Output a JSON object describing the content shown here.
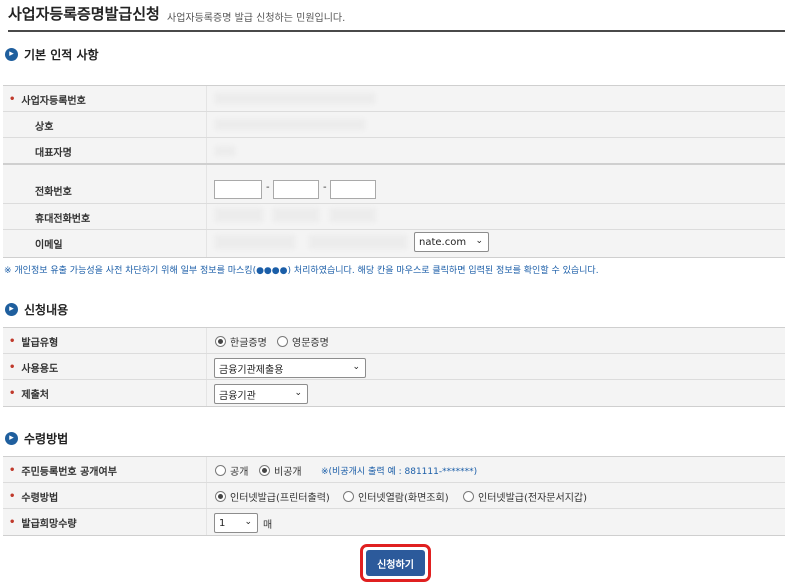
{
  "header": {
    "title": "사업자등록증명발급신청",
    "subtitle": "사업자등록증명 발급 신청하는 민원입니다."
  },
  "section_basic": {
    "icon": "circle-arrow-icon",
    "title": "기본 인적 사항",
    "business_number_label": "사업자등록번호",
    "company_name_label": "상호",
    "representative_label": "대표자명",
    "phone_label": "전화번호",
    "mobile_label": "휴대전화번호",
    "email_label": "이메일",
    "phone_sep": "-",
    "email_domain": "nate.com"
  },
  "privacy_notice": "※ 개인정보 유출 가능성을 사전 차단하기 위해 일부 정보를 마스킹(●●●●) 처리하였습니다. 해당 칸을 마우스로 클릭하면 입력된 정보를 확인할 수 있습니다.",
  "section_request": {
    "title": "신청내용",
    "issue_type_label": "발급유형",
    "issue_type_options": [
      "한글증명",
      "영문증명"
    ],
    "issue_type_selected": "한글증명",
    "purpose_label": "사용용도",
    "purpose_value": "금융기관제출용",
    "submit_to_label": "제출처",
    "submit_to_value": "금융기관"
  },
  "section_receive": {
    "title": "수령방법",
    "rrn_disclosure_label": "주민등록번호 공개여부",
    "rrn_options": [
      "공개",
      "비공개"
    ],
    "rrn_selected": "비공개",
    "rrn_example": "※(비공개시 출력 예 : 881111-*******)",
    "method_label": "수령방법",
    "method_options": [
      "인터넷발급(프린터출력)",
      "인터넷열람(화면조회)",
      "인터넷발급(전자문서지갑)"
    ],
    "method_selected": "인터넷발급(프린터출력)",
    "quantity_label": "발급희망수량",
    "quantity_value": "1",
    "quantity_unit": "매"
  },
  "actions": {
    "submit_label": "신청하기"
  },
  "colors": {
    "accent": "#1f5f9e",
    "submit": "#2c5a9b",
    "highlight_border": "#e02020",
    "required_mark": "#c0392b",
    "notice_text": "#1b5ea8"
  }
}
